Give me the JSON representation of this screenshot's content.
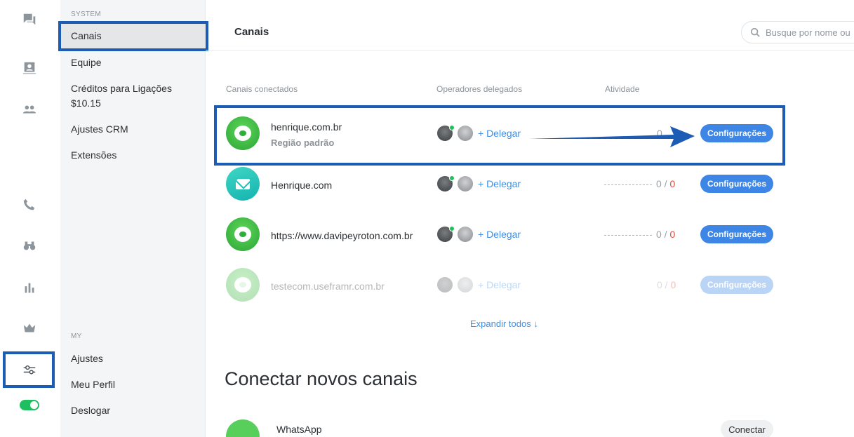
{
  "sidebar": {
    "system_label": "SYSTEM",
    "system_items": [
      {
        "label": "Canais",
        "active": true
      },
      {
        "label": "Equipe"
      },
      {
        "label": "Créditos para Ligações",
        "sub": "$10.15"
      },
      {
        "label": "Ajustes CRM"
      },
      {
        "label": "Extensões"
      }
    ],
    "my_label": "MY",
    "my_items": [
      {
        "label": "Ajustes"
      },
      {
        "label": "Meu Perfil"
      },
      {
        "label": "Deslogar"
      }
    ]
  },
  "rail": {
    "icons": [
      "chat-icon",
      "contact-card-icon",
      "team-icon",
      "phone-icon",
      "binoculars-icon",
      "bar-chart-icon",
      "crown-icon",
      "sliders-icon"
    ],
    "toggle_on": true
  },
  "header": {
    "title": "Canais",
    "search_placeholder": "Busque por nome ou"
  },
  "table": {
    "columns": [
      "Canais conectados",
      "Operadores delegados",
      "Atividade"
    ],
    "rows": [
      {
        "name": "henrique.com.br",
        "sub": "Região padrão",
        "type": "chat",
        "delegate": "+ Delegar",
        "activity_a": "0",
        "activity_b": "0",
        "button": "Configurações"
      },
      {
        "name": "Henrique.com",
        "type": "mail",
        "delegate": "+ Delegar",
        "activity_a": "0",
        "activity_b": "0",
        "button": "Configurações"
      },
      {
        "name": "https://www.davipeyroton.com.br",
        "type": "chat",
        "delegate": "+ Delegar",
        "activity_a": "0",
        "activity_b": "0",
        "button": "Configurações"
      },
      {
        "name": "testecom.useframr.com.br",
        "type": "chat",
        "delegate": "+ Delegar",
        "activity_a": "0",
        "activity_b": "0",
        "button": "Configurações"
      }
    ],
    "expand_label": "Expandir todos ↓"
  },
  "connect": {
    "title": "Conectar novos canais",
    "items": [
      {
        "name": "WhatsApp",
        "button": "Conectar"
      }
    ]
  },
  "colors": {
    "accent": "#3d86e6",
    "annotation": "#1d5cb5",
    "online": "#22c05c"
  }
}
